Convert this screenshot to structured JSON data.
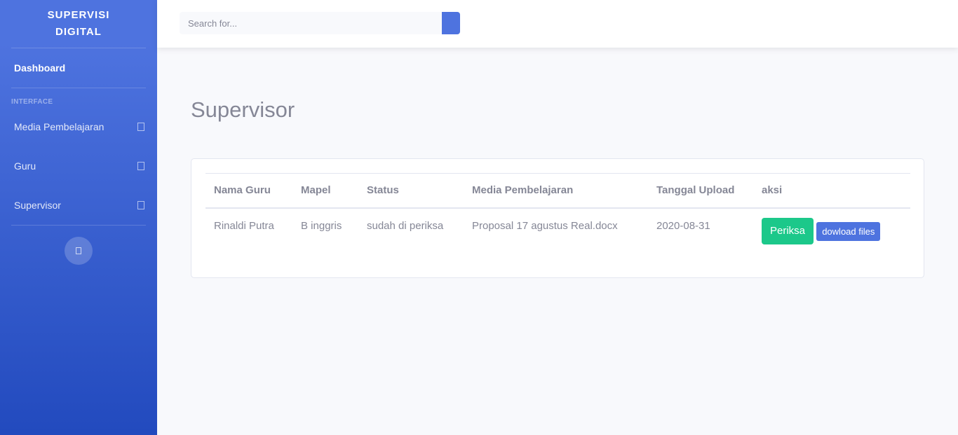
{
  "sidebar": {
    "brand_line1": "SUPERVISI",
    "brand_line2": "DIGITAL",
    "dashboard": "Dashboard",
    "heading": "INTERFACE",
    "items": [
      {
        "label": "Media Pembelajaran"
      },
      {
        "label": "Guru"
      },
      {
        "label": "Supervisor"
      }
    ]
  },
  "search": {
    "placeholder": "Search for..."
  },
  "main": {
    "title": "Supervisor",
    "table": {
      "headers": [
        "Nama Guru",
        "Mapel",
        "Status",
        "Media Pembelajaran",
        "Tanggal Upload",
        "aksi"
      ],
      "rows": [
        {
          "nama_guru": "Rinaldi Putra",
          "mapel": "B inggris",
          "status": "sudah di periksa",
          "media": "Proposal 17 agustus Real.docx",
          "tanggal": "2020-08-31",
          "btn_periksa": "Periksa",
          "btn_download": "dowload files"
        }
      ]
    }
  },
  "colors": {
    "primary": "#4e73df",
    "success": "#1cc88a",
    "text_muted": "#858796"
  }
}
